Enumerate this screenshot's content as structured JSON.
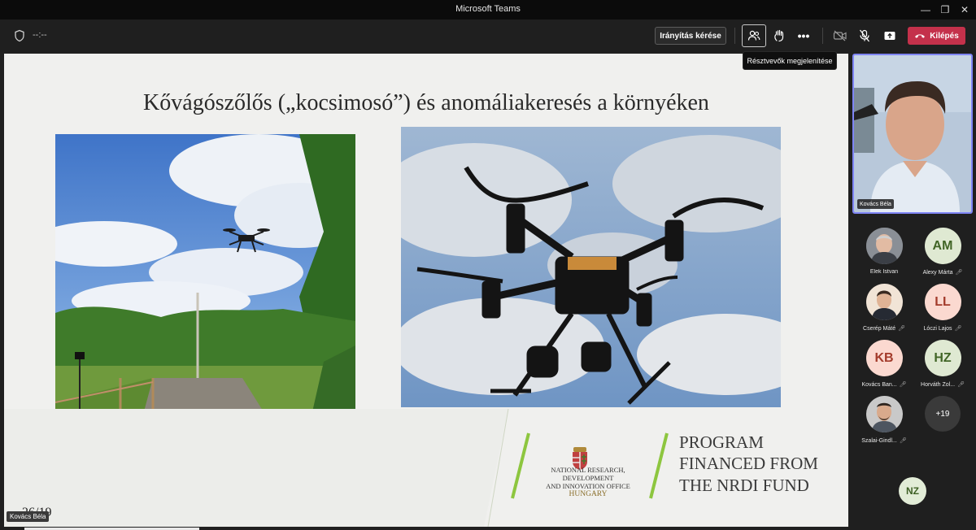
{
  "window": {
    "title": "Microsoft Teams"
  },
  "toolbar": {
    "timer": "--:--",
    "control_label": "Irányítás kérése",
    "leave_label": "Kilépés",
    "tooltip": "Résztvevők megjelenítése"
  },
  "slide": {
    "title": "Kővágószőlős („kocsimosó”) és anomáliakeresés a környéken",
    "nrdi_line1": "NATIONAL RESEARCH, DEVELOPMENT",
    "nrdi_line2": "AND INNOVATION OFFICE",
    "nrdi_line3": "HUNGARY",
    "program_line1": "PROGRAM",
    "program_line2": "FINANCED FROM",
    "program_line3": "THE NRDI FUND",
    "page_number": "26/19",
    "presenter": "Kovács Béla"
  },
  "panel": {
    "main_video_name": "Kovács Béla",
    "participants": [
      {
        "name": "Elek Istvan",
        "initials": "",
        "kind": "photo"
      },
      {
        "name": "Alexy Márta",
        "initials": "AM",
        "kind": "green"
      },
      {
        "name": "Cserép Máté",
        "initials": "",
        "kind": "photo"
      },
      {
        "name": "Lóczi Lajos",
        "initials": "LL",
        "kind": "pink"
      },
      {
        "name": "Kovács Ban...",
        "initials": "KB",
        "kind": "pink"
      },
      {
        "name": "Horváth Zol...",
        "initials": "HZ",
        "kind": "green"
      },
      {
        "name": "Szalai-Gindl...",
        "initials": "",
        "kind": "photo"
      }
    ],
    "more_count": "+19",
    "bottom_avatar": "NZ"
  },
  "colors": {
    "accent": "#7f85f5",
    "leave": "#c4314b",
    "slide_green": "#8dc63f"
  }
}
